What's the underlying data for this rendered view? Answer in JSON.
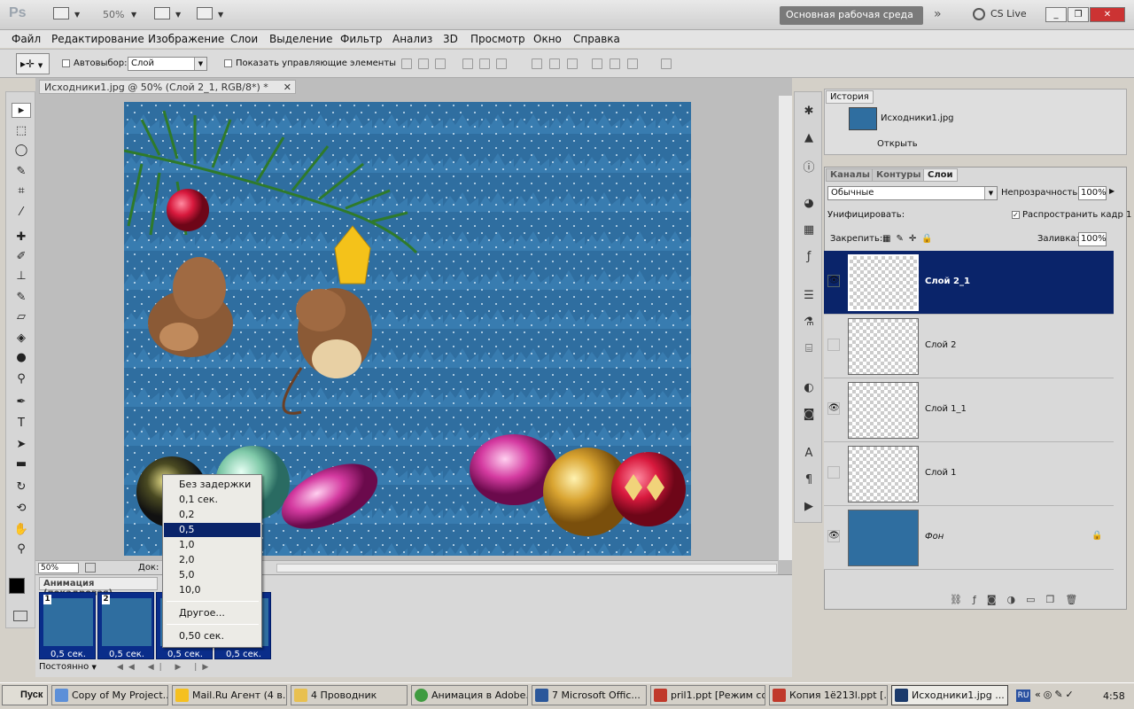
{
  "app": {
    "logo": "Ps",
    "zoom": "50%",
    "workspace": "Основная рабочая среда",
    "cs_live": "CS Live"
  },
  "colors": {
    "selection": "#0a246a",
    "canvas_bg": "#2f6ea0",
    "frame_bg": "#0a2d8a"
  },
  "menu": [
    "Файл",
    "Редактирование",
    "Изображение",
    "Слои",
    "Выделение",
    "Фильтр",
    "Анализ",
    "3D",
    "Просмотр",
    "Окно",
    "Справка"
  ],
  "options": {
    "auto_select": "Автовыбор:",
    "auto_select_value": "Слой",
    "show_controls": "Показать управляющие элементы"
  },
  "document": {
    "tab": "Исходники1.jpg @ 50% (Слой 2_1, RGB/8*) *",
    "zoom": "50%",
    "doc_label": "Док:"
  },
  "animation": {
    "title": "Анимация (покадровая)",
    "frames": [
      {
        "num": "1",
        "delay": "0,5 сек."
      },
      {
        "num": "2",
        "delay": "0,5 сек."
      },
      {
        "delay": "0,5 сек."
      },
      {
        "delay": "0,5 сек."
      }
    ],
    "loop": "Постоянно"
  },
  "delay_menu": {
    "items": [
      "Без задержки",
      "0,1 сек.",
      "0,2",
      "0,5",
      "1,0",
      "2,0",
      "5,0",
      "10,0"
    ],
    "selected": "0,5",
    "other": "Другое...",
    "current": "0,50 сек."
  },
  "history": {
    "tab": "История",
    "snapshot": "Исходники1.jpg",
    "step": "Открыть"
  },
  "layers_panel": {
    "tabs": [
      "Каналы",
      "Контуры",
      "Слои"
    ],
    "blend": "Обычные",
    "opacity_label": "Непрозрачность:",
    "opacity": "100%",
    "unify_label": "Унифицировать:",
    "propagate": "Распространить кадр 1",
    "lock_label": "Закрепить:",
    "fill_label": "Заливка:",
    "fill": "100%",
    "layers": [
      {
        "name": "Слой 2_1",
        "visible": true,
        "selected": true
      },
      {
        "name": "Слой 2",
        "visible": false
      },
      {
        "name": "Слой 1_1",
        "visible": true
      },
      {
        "name": "Слой 1",
        "visible": false
      },
      {
        "name": "Фон",
        "visible": true
      }
    ]
  },
  "taskbar": {
    "start": "Пуск",
    "items": [
      "Copy of My Project...",
      "Mail.Ru Агент (4 в...",
      "4 Проводник",
      "Анимация в Adobe...",
      "7 Microsoft Offic...",
      "pril1.ppt [Режим со...",
      "Копия 1ё213l.ppt [...",
      "Исходники1.jpg ..."
    ],
    "lang": "RU",
    "clock": "4:58"
  }
}
